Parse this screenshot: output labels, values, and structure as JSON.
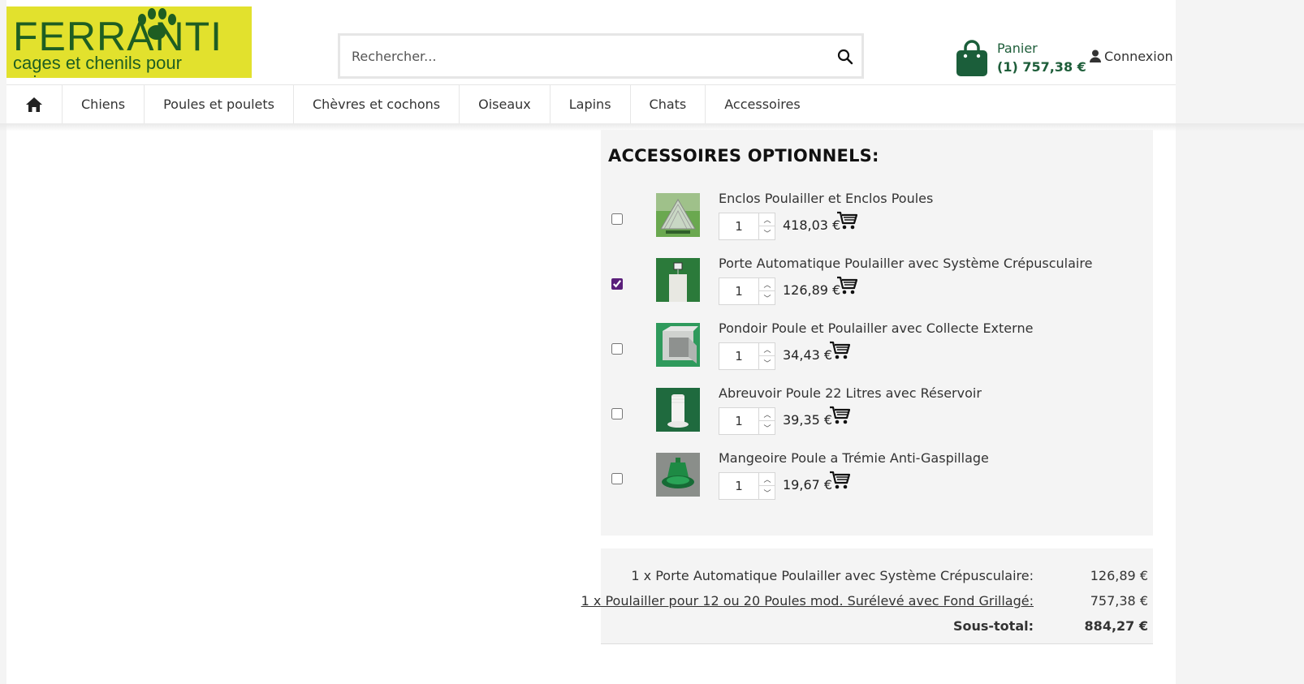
{
  "logo": {
    "brand": "FERRANTI",
    "tagline": "cages et chenils pour animaux"
  },
  "search": {
    "placeholder": "Rechercher..."
  },
  "cart": {
    "label": "Panier",
    "total": "(1) 757,38 €"
  },
  "account": {
    "login_label": "Connexion"
  },
  "nav": {
    "items": [
      "Chiens",
      "Poules et poulets",
      "Chèvres et cochons",
      "Oiseaux",
      "Lapins",
      "Chats",
      "Accessoires"
    ]
  },
  "accessories": {
    "title": "ACCESSOIRES OPTIONNELS:",
    "items": [
      {
        "name": "Enclos Poulailler et Enclos Poules",
        "qty": "1",
        "price": "418,03 €",
        "checked": false,
        "image": "chicken-run-enclosure"
      },
      {
        "name": "Porte Automatique Poulailler avec Système Crépusculaire",
        "qty": "1",
        "price": "126,89 €",
        "checked": true,
        "image": "automatic-door"
      },
      {
        "name": "Pondoir Poule et Poulailler avec Collecte Externe",
        "qty": "1",
        "price": "34,43 €",
        "checked": false,
        "image": "nesting-box"
      },
      {
        "name": "Abreuvoir Poule 22 Litres avec Réservoir",
        "qty": "1",
        "price": "39,35 €",
        "checked": false,
        "image": "water-drinker"
      },
      {
        "name": "Mangeoire Poule a Trémie Anti-Gaspillage",
        "qty": "1",
        "price": "19,67 €",
        "checked": false,
        "image": "hopper-feeder"
      }
    ]
  },
  "summary": {
    "lines": [
      {
        "label": "1 x Porte Automatique Poulailler avec Système Crépusculaire:",
        "value": "126,89 €"
      },
      {
        "label": "1 x Poulailler pour 12 ou 20 Poules mod. Surélevé avec Fond Grillagé:",
        "value": "757,38 €"
      }
    ],
    "subtotal_label": "Sous-total:",
    "subtotal_value": "884,27 €"
  },
  "colors": {
    "brand_yellow": "#e2e12d",
    "brand_green": "#1e5e22",
    "cart_green": "#1b5e3a",
    "panel_bg": "#f4f4f4"
  },
  "icons": [
    "paw-icon",
    "search-icon",
    "shopping-bag-icon",
    "user-icon",
    "home-icon",
    "add-to-cart-icon"
  ]
}
